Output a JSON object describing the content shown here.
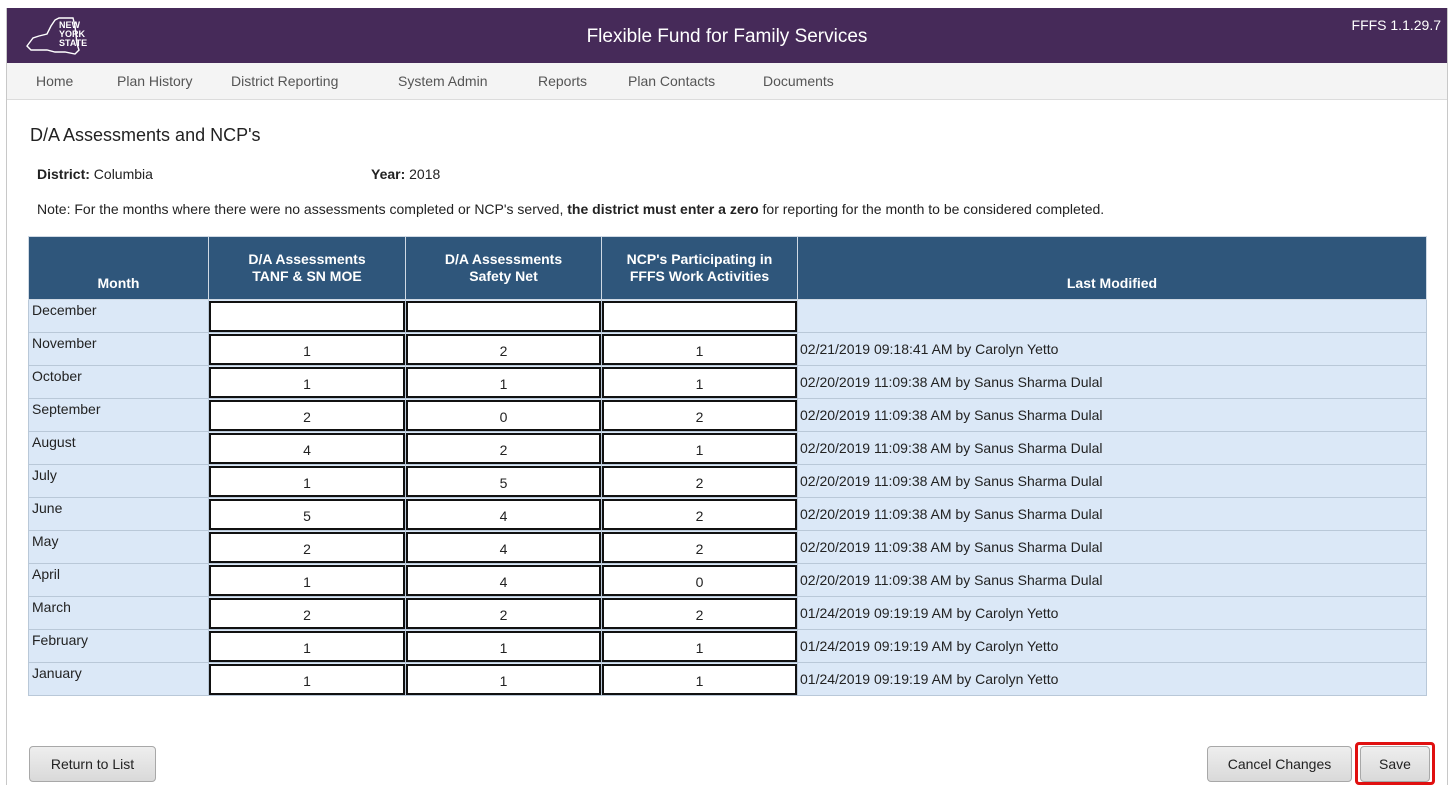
{
  "header": {
    "logo_lines": [
      "NEW",
      "YORK",
      "STATE"
    ],
    "app_title": "Flexible Fund for Family Services",
    "version": "FFFS 1.1.29.7",
    "color": "#462a59"
  },
  "nav": {
    "items": [
      {
        "label": "Home"
      },
      {
        "label": "Plan History"
      },
      {
        "label": "District Reporting"
      },
      {
        "label": "System Admin"
      },
      {
        "label": "Reports"
      },
      {
        "label": "Plan Contacts"
      },
      {
        "label": "Documents"
      }
    ]
  },
  "page": {
    "title": "D/A Assessments and NCP's",
    "district_label": "District:",
    "district_value": "Columbia",
    "year_label": "Year:",
    "year_value": "2018",
    "note_prefix": "Note: For the months where there were no assessments completed or NCP's served,",
    "note_bold": "the district must enter a zero",
    "note_suffix": "for reporting for the month to be considered completed."
  },
  "table": {
    "header_color": "#2f567b",
    "row_color": "#dbe8f7",
    "columns": [
      {
        "line1": "",
        "line2": "Month"
      },
      {
        "line1": "D/A Assessments",
        "line2": "TANF & SN MOE"
      },
      {
        "line1": "D/A Assessments",
        "line2": "Safety Net"
      },
      {
        "line1": "NCP's Participating in",
        "line2": "FFFS Work Activities"
      },
      {
        "line1": "",
        "line2": "Last Modified"
      }
    ],
    "rows": [
      {
        "month": "December",
        "tanf": "",
        "sn": "",
        "ncp": "",
        "modified": ""
      },
      {
        "month": "November",
        "tanf": "1",
        "sn": "2",
        "ncp": "1",
        "modified": "02/21/2019 09:18:41 AM by Carolyn Yetto"
      },
      {
        "month": "October",
        "tanf": "1",
        "sn": "1",
        "ncp": "1",
        "modified": "02/20/2019 11:09:38 AM by Sanus Sharma Dulal"
      },
      {
        "month": "September",
        "tanf": "2",
        "sn": "0",
        "ncp": "2",
        "modified": "02/20/2019 11:09:38 AM by Sanus Sharma Dulal"
      },
      {
        "month": "August",
        "tanf": "4",
        "sn": "2",
        "ncp": "1",
        "modified": "02/20/2019 11:09:38 AM by Sanus Sharma Dulal"
      },
      {
        "month": "July",
        "tanf": "1",
        "sn": "5",
        "ncp": "2",
        "modified": "02/20/2019 11:09:38 AM by Sanus Sharma Dulal"
      },
      {
        "month": "June",
        "tanf": "5",
        "sn": "4",
        "ncp": "2",
        "modified": "02/20/2019 11:09:38 AM by Sanus Sharma Dulal"
      },
      {
        "month": "May",
        "tanf": "2",
        "sn": "4",
        "ncp": "2",
        "modified": "02/20/2019 11:09:38 AM by Sanus Sharma Dulal"
      },
      {
        "month": "April",
        "tanf": "1",
        "sn": "4",
        "ncp": "0",
        "modified": "02/20/2019 11:09:38 AM by Sanus Sharma Dulal"
      },
      {
        "month": "March",
        "tanf": "2",
        "sn": "2",
        "ncp": "2",
        "modified": "01/24/2019 09:19:19 AM by Carolyn Yetto"
      },
      {
        "month": "February",
        "tanf": "1",
        "sn": "1",
        "ncp": "1",
        "modified": "01/24/2019 09:19:19 AM by Carolyn Yetto"
      },
      {
        "month": "January",
        "tanf": "1",
        "sn": "1",
        "ncp": "1",
        "modified": "01/24/2019 09:19:19 AM by Carolyn Yetto"
      }
    ]
  },
  "buttons": {
    "return_label": "Return to List",
    "cancel_label": "Cancel Changes",
    "save_label": "Save",
    "highlight_color": "#e01010"
  }
}
